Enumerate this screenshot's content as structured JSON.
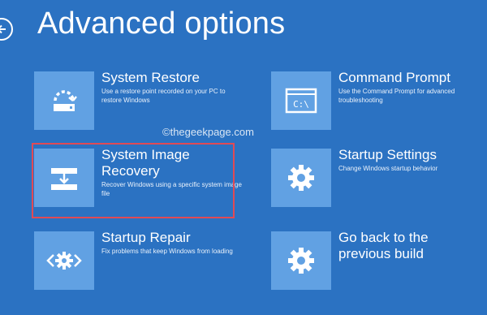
{
  "header": {
    "title": "Advanced options"
  },
  "watermark": "©thegeekpage.com",
  "options": [
    {
      "title": "System Restore",
      "description": "Use a restore point recorded on your PC to restore Windows",
      "icon": "system-restore-icon"
    },
    {
      "title": "Command Prompt",
      "description": "Use the Command Prompt for advanced troubleshooting",
      "icon": "command-prompt-icon"
    },
    {
      "title": "System Image Recovery",
      "title_line1": "System Image",
      "title_line2": "Recovery",
      "description": "Recover Windows using a specific system image file",
      "icon": "system-image-recovery-icon",
      "highlighted": true
    },
    {
      "title": "Startup Settings",
      "description": "Change Windows startup behavior",
      "icon": "gear-icon"
    },
    {
      "title": "Startup Repair",
      "description": "Fix problems that keep Windows from loading",
      "icon": "startup-repair-icon"
    },
    {
      "title": "Go back to the previous build",
      "title_line1": "Go back to the",
      "title_line2": "previous build",
      "description": "",
      "icon": "gear-icon"
    }
  ],
  "colors": {
    "background": "#2b72c2",
    "tile": "#61a1e3",
    "highlight_border": "#e04a55",
    "text": "#ffffff"
  }
}
